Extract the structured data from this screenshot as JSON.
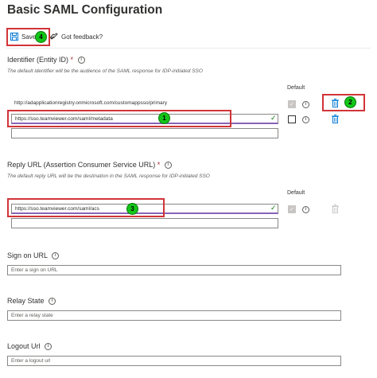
{
  "page": {
    "title": "Basic SAML Configuration"
  },
  "toolbar": {
    "save_label": "Save",
    "feedback_label": "Got feedback?"
  },
  "identifier": {
    "label": "Identifier (Entity ID)",
    "required_mark": "*",
    "hint": "The default identifier will be the audience of the SAML response for IDP-initiated SSO",
    "default_header": "Default",
    "existing_value": "http://adapplicationregistry.onmicrosoft.com/customappsso/primary",
    "value": "https://sso.teamviewer.com/saml/metadata",
    "empty_value": ""
  },
  "reply_url": {
    "label": "Reply URL (Assertion Consumer Service URL)",
    "required_mark": "*",
    "hint": "The default reply URL will be the destination in the SAML response for IDP-initiated SSO",
    "default_header": "Default",
    "value": "https://sso.teamviewer.com/saml/acs",
    "empty_value": ""
  },
  "sign_on_url": {
    "label": "Sign on URL",
    "placeholder": "Enter a sign on URL"
  },
  "relay_state": {
    "label": "Relay State",
    "placeholder": "Enter a relay state"
  },
  "logout_url": {
    "label": "Logout Url",
    "placeholder": "Enter a logout url"
  },
  "callouts": {
    "one": "1",
    "two": "2",
    "three": "3",
    "four": "4"
  },
  "colors": {
    "highlight": "#d13438",
    "badge": "#13c518",
    "accent": "#0078d4",
    "focus_underline": "#8764b8"
  }
}
